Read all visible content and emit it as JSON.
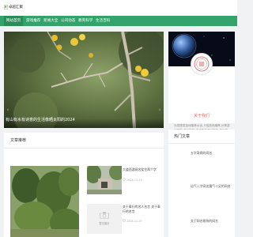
{
  "header": {
    "logo_alt": "卓越汇聚"
  },
  "nav": {
    "items": [
      "网站首页",
      "游戏推荐",
      "新闻大全",
      "公司动态",
      "教育科学",
      "生活百科"
    ]
  },
  "slider": {
    "caption": "有山有水有诗意的生活像晒太阳的2024"
  },
  "about": {
    "title": "关于我们",
    "description": "为您提供游戏推荐大全,介绍游戏推荐,分享游戏推荐,游戏推荐,游戏推荐游戏推荐,游戏推荐,游戏推荐游戏推荐,游戏推荐,游戏推荐游戏推荐最新游戏推荐"
  },
  "recommend": {
    "title": "文章推荐",
    "items": [
      {
        "title": "大道西游网名女生两个字",
        "date": "2024-11-25"
      },
      {
        "title": "关于奉行的名人名言 关于奉行的名言",
        "date": "2024-11-25"
      }
    ],
    "placeholder_label": "暂无图片"
  },
  "hot": {
    "title": "热门文章",
    "items": [
      "五字哥俩的网名",
      "",
      "仙气二字网名霸气十足的网名",
      "",
      "关于网名雅致的网名"
    ]
  }
}
